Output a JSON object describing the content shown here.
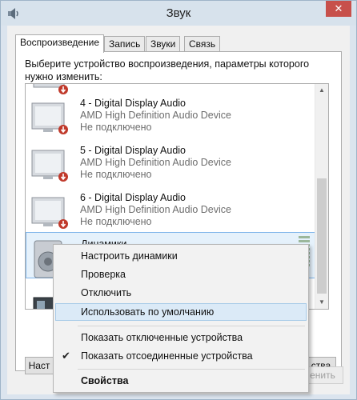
{
  "window": {
    "title": "Звук",
    "close_label": "✕",
    "app_icon": "speaker-settings-icon"
  },
  "tabs": [
    {
      "label": "Воспроизведение",
      "active": true
    },
    {
      "label": "Запись",
      "active": false
    },
    {
      "label": "Звуки",
      "active": false
    },
    {
      "label": "Связь",
      "active": false
    }
  ],
  "instruction": "Выберите устройство воспроизведения, параметры которого нужно изменить:",
  "devices": [
    {
      "name": "4 - Digital Display Audio",
      "driver": "AMD High Definition Audio Device",
      "status": "Не подключено",
      "icon": "monitor-speaker-icon",
      "badge": "disconnected-icon"
    },
    {
      "name": "5 - Digital Display Audio",
      "driver": "AMD High Definition Audio Device",
      "status": "Не подключено",
      "icon": "monitor-speaker-icon",
      "badge": "disconnected-icon"
    },
    {
      "name": "6 - Digital Display Audio",
      "driver": "AMD High Definition Audio Device",
      "status": "Не подключено",
      "icon": "monitor-speaker-icon",
      "badge": "disconnected-icon"
    },
    {
      "name": "Динамики",
      "driver": "",
      "status": "",
      "icon": "speakers-icon",
      "badge": "",
      "selected": true
    }
  ],
  "buttons": {
    "configure_partial": "Наст",
    "properties_partial": "ства",
    "apply_partial": "енить"
  },
  "context_menu": {
    "items": [
      {
        "label": "Настроить динамики"
      },
      {
        "label": "Проверка"
      },
      {
        "label": "Отключить"
      },
      {
        "label": "Использовать по умолчанию",
        "highlighted": true
      },
      {
        "label": "Показать отключенные устройства"
      },
      {
        "label": "Показать отсоединенные устройства",
        "checked": true
      },
      {
        "label": "Свойства",
        "bold": true
      }
    ],
    "check_glyph": "✔"
  },
  "colors": {
    "selection": "#e5f1fb",
    "menu_highlight": "#dbeaf7",
    "close_button": "#c7504b",
    "disconnected_badge": "#c0392b"
  }
}
